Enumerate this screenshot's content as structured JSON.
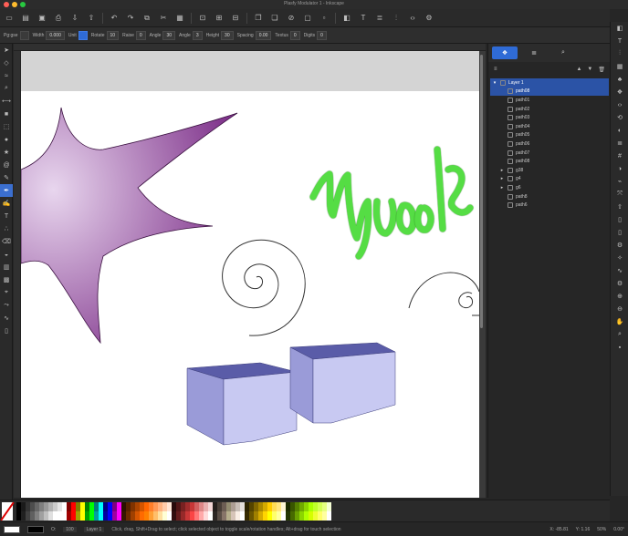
{
  "window": {
    "title": "Plasfy Modulator 1 - Inkscape"
  },
  "toolbar": {
    "icons": [
      "new-icon",
      "open-icon",
      "save-icon",
      "print-icon",
      "import-icon",
      "export-icon",
      "undo-icon",
      "redo-icon",
      "copy-icon",
      "cut-icon",
      "paste-icon",
      "zoom-selection-icon",
      "zoom-drawing-icon",
      "zoom-page-icon",
      "duplicate-icon",
      "clone-icon",
      "unlink-icon",
      "group-icon",
      "ungroup-icon",
      "fill-stroke-icon",
      "text-icon",
      "layers-icon",
      "align-icon",
      "xml-icon",
      "preferences-icon"
    ]
  },
  "controls": {
    "items": [
      {
        "label": "Pg:gse",
        "value": ""
      },
      {
        "label": "Width",
        "value": "0.000"
      },
      {
        "label": "Unit",
        "value": ""
      },
      {
        "label": "Rotate",
        "value": "10"
      },
      {
        "label": "Raise",
        "value": "0"
      },
      {
        "label": "Angle",
        "value": "30"
      },
      {
        "label": "Angle",
        "value": "3"
      },
      {
        "label": "Height",
        "value": "30"
      },
      {
        "label": "Spacing",
        "value": "0.00"
      },
      {
        "label": "Textus",
        "value": "0"
      },
      {
        "label": "Digits",
        "value": "0"
      }
    ]
  },
  "toolbox": {
    "tools": [
      "selector-icon",
      "node-icon",
      "tweak-icon",
      "zoom-icon",
      "measure-icon",
      "rect-icon",
      "3dbox-icon",
      "ellipse-icon",
      "star-icon",
      "spiral-icon",
      "pencil-icon",
      "pen-icon",
      "calligraphy-icon",
      "text-icon",
      "spray-icon",
      "eraser-icon",
      "bucket-icon",
      "gradient-icon",
      "mesh-icon",
      "dropper-icon",
      "connector-icon",
      "lpe-icon",
      "pages-icon"
    ],
    "selected_index": 11
  },
  "panel": {
    "tabs": [
      {
        "icon": "objects-icon",
        "label": ""
      },
      {
        "icon": "layers-tab-icon",
        "label": ""
      },
      {
        "icon": "search-icon",
        "label": ""
      }
    ],
    "tree": [
      {
        "label": "Layer 1",
        "kind": "layer",
        "expanded": true
      },
      {
        "label": "path08",
        "kind": "sel"
      },
      {
        "label": "path01",
        "kind": "item"
      },
      {
        "label": "path02",
        "kind": "item"
      },
      {
        "label": "path03",
        "kind": "item"
      },
      {
        "label": "path04",
        "kind": "item"
      },
      {
        "label": "path05",
        "kind": "item"
      },
      {
        "label": "path06",
        "kind": "item"
      },
      {
        "label": "path07",
        "kind": "item"
      },
      {
        "label": "path08",
        "kind": "item"
      },
      {
        "label": "g38",
        "kind": "group"
      },
      {
        "label": "g4",
        "kind": "group"
      },
      {
        "label": "g6",
        "kind": "group"
      },
      {
        "label": "path8",
        "kind": "item"
      },
      {
        "label": "path6",
        "kind": "item"
      }
    ]
  },
  "right_icons": [
    "fill-stroke-icon",
    "text-icon",
    "align-icon",
    "swatches-icon",
    "symbols-icon",
    "objects-icon",
    "xml-editor-icon",
    "undo-history-icon",
    "filters-icon",
    "layers-icon",
    "selectors-icon",
    "paint-servers-icon",
    "snap-icon",
    "transform-icon",
    "export-icon",
    "document-icon",
    "pages-icon",
    "preferences-icon",
    "trace-icon",
    "path-effects-icon",
    "gear-icon",
    "zoom-in-icon",
    "zoom-out-icon",
    "hand-icon",
    "zoom-icon",
    "pointer-icon"
  ],
  "palette": {
    "colors": [
      "#000000",
      "#1a1a1a",
      "#333333",
      "#4d4d4d",
      "#666666",
      "#808080",
      "#999999",
      "#b3b3b3",
      "#cccccc",
      "#e6e6e6",
      "#ffffff",
      "#800000",
      "#ff0000",
      "#808000",
      "#ffff00",
      "#008000",
      "#00ff00",
      "#008080",
      "#00ffff",
      "#000080",
      "#0000ff",
      "#800080",
      "#ff00ff",
      "#2b1100",
      "#552200",
      "#803300",
      "#aa4400",
      "#d45500",
      "#ff6600",
      "#ff7f2a",
      "#ff9955",
      "#ffb380",
      "#ffccaa",
      "#ffe6d5",
      "#280b0b",
      "#501616",
      "#782121",
      "#a02c2c",
      "#c83737",
      "#d35f5f",
      "#de8787",
      "#e9afaf",
      "#f4d7d7",
      "#241f1c",
      "#483e37",
      "#6c5d53",
      "#918a6f",
      "#ac9d93",
      "#c8beb7",
      "#e3dedb",
      "#2b2200",
      "#554400",
      "#806600",
      "#aa8800",
      "#d4aa00",
      "#ffcc00",
      "#ffdd55",
      "#ffe680",
      "#fff6d5",
      "#1c2b00",
      "#395500",
      "#558000",
      "#71aa00",
      "#8dd400",
      "#aaff00",
      "#bfff2a",
      "#d4ff55",
      "#e5ff80",
      "#f5ffd5"
    ]
  },
  "status": {
    "opacity_label": "O:",
    "opacity_value": "100",
    "layer_label": "Layer 1",
    "message": "Click, drag, Shift+Drag to select; click selected object to toggle scale/rotation handles; Alt+drag for touch selection",
    "x": "X: -85.81",
    "y": "Y: 1.16",
    "zoom": "50%",
    "rotation": "0.00°"
  },
  "canvas": {
    "star_fill_start": "#e8d6ee",
    "star_fill_end": "#7a2b86",
    "text_fill": "#55dd44",
    "box_front": "#9a9bd8",
    "box_top": "#5a5ca8",
    "box_side": "#c8c9f2"
  }
}
